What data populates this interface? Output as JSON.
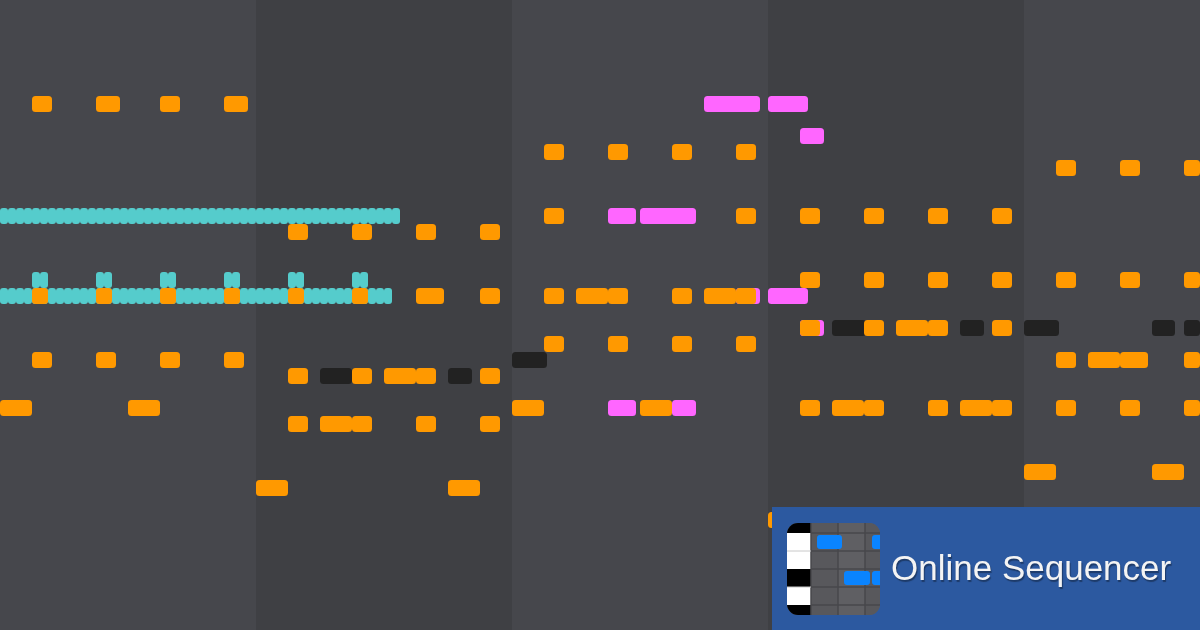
{
  "piano_roll": {
    "tracks": [
      {
        "color": "#ff9900"
      },
      {
        "color": "#55cccc"
      },
      {
        "color": "#ff66ff"
      },
      {
        "color": "#222222"
      }
    ]
  },
  "brand": {
    "name": "Online Sequencer"
  }
}
